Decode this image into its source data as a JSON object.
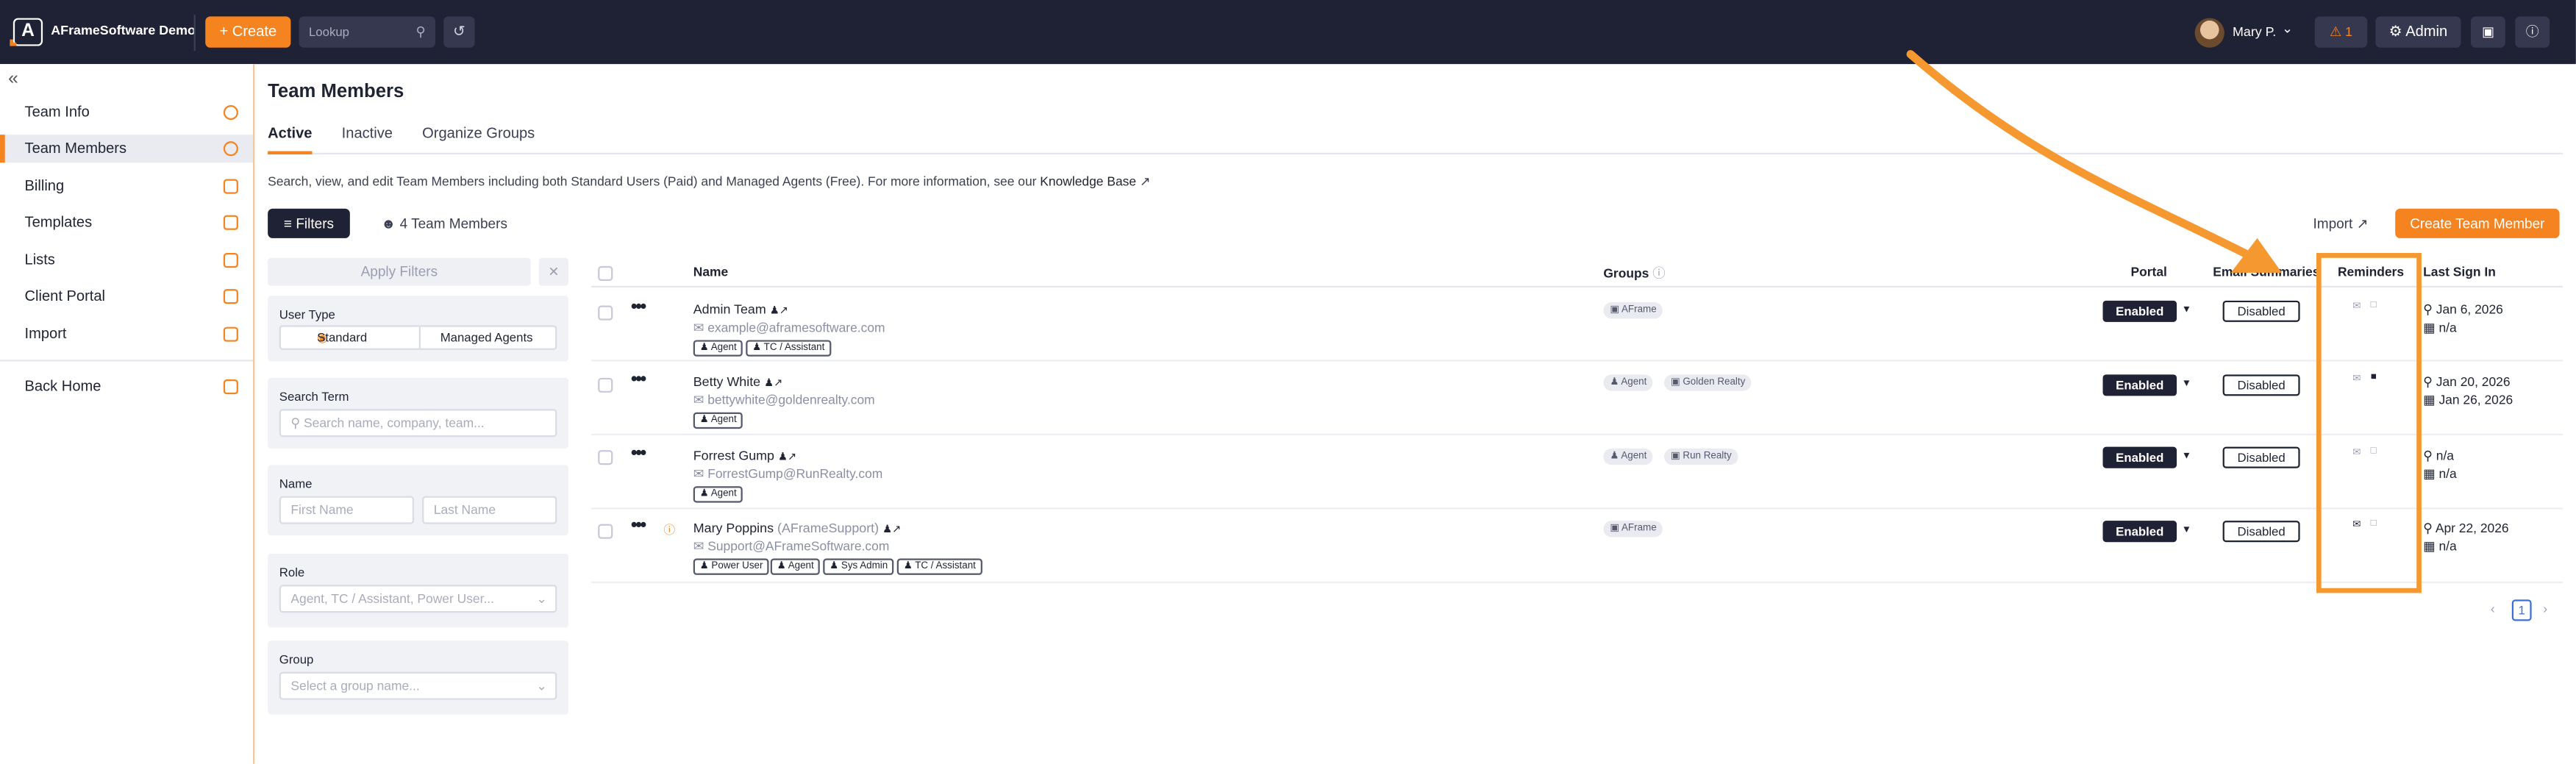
{
  "topbar": {
    "logo_letter": "A",
    "brand": "AFrameSoftware Demo",
    "create_label": "+ Create",
    "lookup_placeholder": "Lookup",
    "user_name": "Mary P.",
    "notifications_count": "1",
    "admin_label": "Admin",
    "icons": [
      "logo-icon",
      "plus-icon",
      "search-icon",
      "history-icon",
      "chevron-down-icon",
      "bell-icon",
      "gear-icon",
      "gift-icon",
      "help-icon"
    ]
  },
  "sidebar": {
    "items": [
      {
        "label": "Team Info",
        "icon": "gear-icon"
      },
      {
        "label": "Team Members",
        "icon": "person-icon"
      },
      {
        "label": "Billing",
        "icon": "card-icon"
      },
      {
        "label": "Templates",
        "icon": "document-icon"
      },
      {
        "label": "Lists",
        "icon": "list-icon"
      },
      {
        "label": "Client Portal",
        "icon": "card-icon"
      },
      {
        "label": "Import",
        "icon": "file-icon"
      },
      {
        "label": "Back Home",
        "icon": "grid-icon"
      }
    ]
  },
  "page": {
    "title": "Team Members",
    "tabs": [
      "Active",
      "Inactive",
      "Organize Groups"
    ],
    "description": "Search, view, and edit Team Members including both Standard Users (Paid) and Managed Agents (Free). For more information, see our ",
    "knowledge_base": "Knowledge Base",
    "filters_label": "Filters",
    "member_count": "4 Team Members",
    "import_label": "Import",
    "create_member_label": "Create Team Member"
  },
  "filters": {
    "apply_label": "Apply Filters",
    "clear": "✕",
    "user_type_label": "User Type",
    "user_type_options": [
      "Standard",
      "Managed Agents"
    ],
    "search_term_label": "Search Term",
    "search_placeholder": "Search name, company, team...",
    "name_label": "Name",
    "first_name_placeholder": "First Name",
    "last_name_placeholder": "Last Name",
    "role_label": "Role",
    "role_placeholder": "Agent, TC / Assistant, Power User...",
    "group_label": "Group",
    "group_placeholder": "Select a group name..."
  },
  "table": {
    "columns": [
      "Name",
      "Groups",
      "Portal",
      "Email Summaries",
      "Reminders",
      "Last Sign In"
    ],
    "rows": [
      {
        "name": "Admin Team",
        "sub": "",
        "email": "example@aframesoftware.com",
        "roles": [
          "Agent",
          "TC / Assistant"
        ],
        "groups": [
          "AFrame"
        ],
        "portal": "Enabled",
        "email_summaries": "Disabled",
        "reminder_email_on": false,
        "reminder_sms_on": false,
        "signin_1": "Jan 6, 2026",
        "signin_2": "n/a",
        "warn": false
      },
      {
        "name": "Betty White",
        "sub": "",
        "email": "bettywhite@goldenrealty.com",
        "roles": [
          "Agent"
        ],
        "groups": [
          "Agent",
          "Golden Realty"
        ],
        "portal": "Enabled",
        "email_summaries": "Disabled",
        "reminder_email_on": false,
        "reminder_sms_on": true,
        "signin_1": "Jan 20, 2026",
        "signin_2": "Jan 26, 2026",
        "warn": false
      },
      {
        "name": "Forrest Gump",
        "sub": "",
        "email": "ForrestGump@RunRealty.com",
        "roles": [
          "Agent"
        ],
        "groups": [
          "Agent",
          "Run Realty"
        ],
        "portal": "Enabled",
        "email_summaries": "Disabled",
        "reminder_email_on": false,
        "reminder_sms_on": false,
        "signin_1": "n/a",
        "signin_2": "n/a",
        "warn": false
      },
      {
        "name": "Mary Poppins",
        "sub": "(AFrameSupport)",
        "email": "Support@AFrameSoftware.com",
        "roles": [
          "Power User",
          "Agent",
          "Sys Admin",
          "TC / Assistant"
        ],
        "groups": [
          "AFrame"
        ],
        "portal": "Enabled",
        "email_summaries": "Disabled",
        "reminder_email_on": true,
        "reminder_sms_on": false,
        "signin_1": "Apr 22, 2026",
        "signin_2": "n/a",
        "warn": true
      }
    ]
  },
  "pagination": {
    "prev": "‹",
    "current": "1",
    "next": "›"
  },
  "colors": {
    "accent": "#f5831f",
    "navy": "#1f2135",
    "highlight": "#f5982f"
  }
}
